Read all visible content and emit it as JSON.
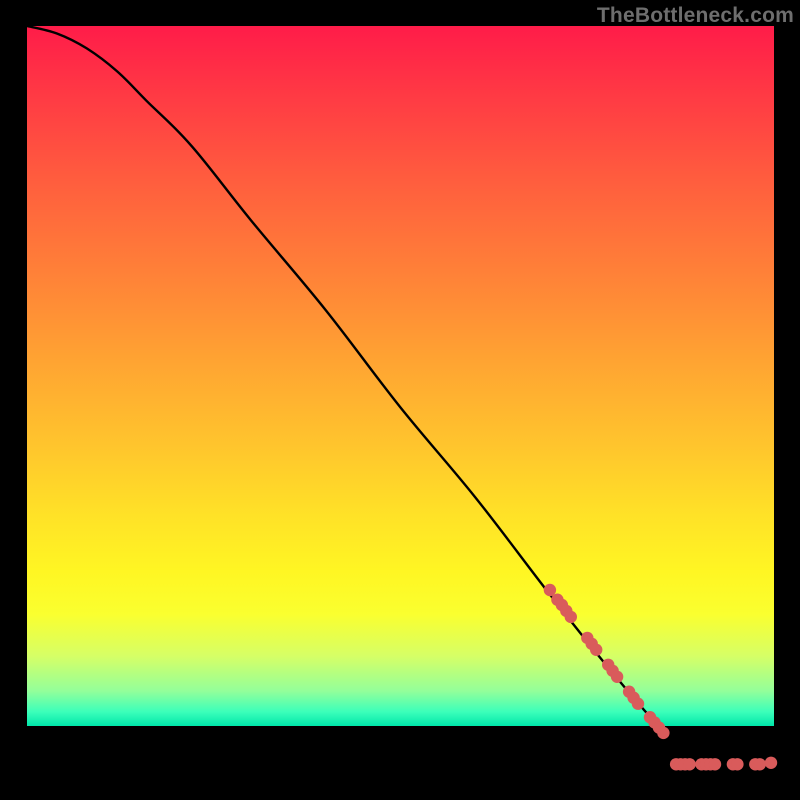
{
  "watermark": "TheBottleneck.com",
  "chart_data": {
    "type": "line",
    "title": "",
    "xlabel": "",
    "ylabel": "",
    "xlim": [
      0,
      100
    ],
    "ylim": [
      0,
      100
    ],
    "curve": {
      "x": [
        0,
        4,
        8,
        12,
        16,
        22,
        30,
        40,
        50,
        60,
        70,
        78,
        85,
        90,
        95,
        100
      ],
      "y": [
        100,
        99,
        97,
        94,
        90,
        84,
        74,
        62,
        49,
        37,
        24,
        14,
        6,
        2,
        1,
        1
      ]
    },
    "markers": {
      "name": "hotspots",
      "color": "#d95b5b",
      "points": [
        {
          "x": 70.0,
          "y": 24.6
        },
        {
          "x": 71.0,
          "y": 23.3
        },
        {
          "x": 71.6,
          "y": 22.6
        },
        {
          "x": 72.2,
          "y": 21.8
        },
        {
          "x": 72.8,
          "y": 21.0
        },
        {
          "x": 75.0,
          "y": 18.2
        },
        {
          "x": 75.6,
          "y": 17.4
        },
        {
          "x": 76.2,
          "y": 16.6
        },
        {
          "x": 77.8,
          "y": 14.6
        },
        {
          "x": 78.4,
          "y": 13.8
        },
        {
          "x": 79.0,
          "y": 13.0
        },
        {
          "x": 80.6,
          "y": 11.0
        },
        {
          "x": 81.2,
          "y": 10.2
        },
        {
          "x": 81.8,
          "y": 9.4
        },
        {
          "x": 83.4,
          "y": 7.6
        },
        {
          "x": 84.0,
          "y": 6.9
        },
        {
          "x": 84.6,
          "y": 6.2
        },
        {
          "x": 85.2,
          "y": 5.5
        },
        {
          "x": 86.9,
          "y": 1.3
        },
        {
          "x": 87.5,
          "y": 1.3
        },
        {
          "x": 88.1,
          "y": 1.3
        },
        {
          "x": 88.7,
          "y": 1.3
        },
        {
          "x": 90.3,
          "y": 1.3
        },
        {
          "x": 90.9,
          "y": 1.3
        },
        {
          "x": 91.5,
          "y": 1.3
        },
        {
          "x": 92.1,
          "y": 1.3
        },
        {
          "x": 94.5,
          "y": 1.3
        },
        {
          "x": 95.1,
          "y": 1.3
        },
        {
          "x": 97.5,
          "y": 1.3
        },
        {
          "x": 98.1,
          "y": 1.3
        },
        {
          "x": 99.6,
          "y": 1.5
        }
      ]
    }
  }
}
